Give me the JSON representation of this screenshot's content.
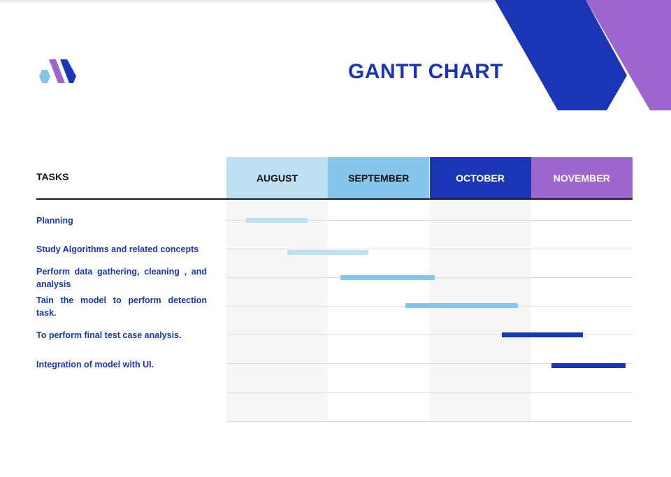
{
  "title": "GANTT CHART",
  "colors": {
    "accent_blue": "#1a35b5",
    "accent_purple": "#9d66cf",
    "light_blue": "#bfe0f3",
    "sky_blue": "#86c6ec",
    "task_text": "#1a35b5",
    "column_shade": "#f6f6f6"
  },
  "tasks_header": "TASKS",
  "months": [
    {
      "label": "AUGUST",
      "bg": "#bfe0f3",
      "color": "#111111"
    },
    {
      "label": "SEPTEMBER",
      "bg": "#86c6ec",
      "color": "#111111"
    },
    {
      "label": "OCTOBER",
      "bg": "#1a35b5",
      "color": "#ffffff"
    },
    {
      "label": "NOVEMBER",
      "bg": "#9d66cf",
      "color": "#ffffff"
    }
  ],
  "tasks": [
    {
      "label": "Planning",
      "start": 0.19,
      "end": 0.8,
      "color": "#bfe0f3"
    },
    {
      "label": "Study Algorithms and related concepts",
      "start": 0.6,
      "end": 1.4,
      "color": "#bfe0f3"
    },
    {
      "label": "Perform data gathering, cleaning , and analysis",
      "start": 1.12,
      "end": 2.05,
      "color": "#86c6ec"
    },
    {
      "label": "Tain the model to perform detection task.",
      "start": 1.76,
      "end": 2.87,
      "color": "#86c6ec"
    },
    {
      "label": "To perform final test case analysis.",
      "start": 2.71,
      "end": 3.51,
      "color": "#1a35b5"
    },
    {
      "label": "Integration of model with UI.",
      "start": 3.2,
      "end": 3.93,
      "color": "#1a35b5"
    }
  ]
}
